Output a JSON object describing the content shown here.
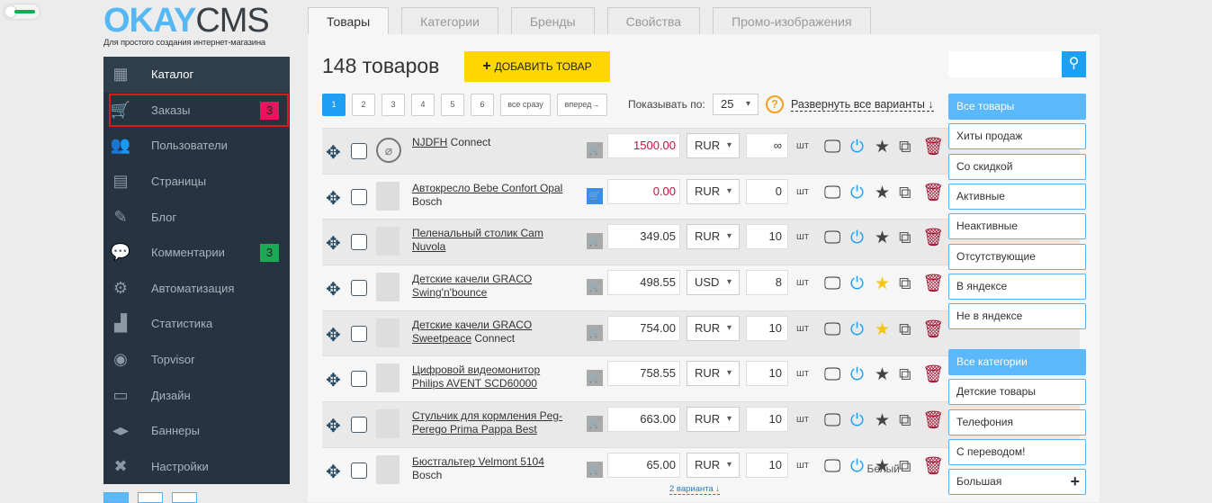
{
  "logo": {
    "okay": "OKAY",
    "cms": "CMS",
    "tagline": "Для простого создания интернет-магазина"
  },
  "sidebar": {
    "items": [
      {
        "label": "Каталог",
        "icon": "grid-icon",
        "active": true
      },
      {
        "label": "Заказы",
        "icon": "cart-icon",
        "badge": "3",
        "badge_color": "#e8155e",
        "highlighted": true
      },
      {
        "label": "Пользователи",
        "icon": "users-icon"
      },
      {
        "label": "Страницы",
        "icon": "page-icon"
      },
      {
        "label": "Блог",
        "icon": "edit-icon"
      },
      {
        "label": "Комментарии",
        "icon": "comments-icon",
        "badge": "3",
        "badge_color": "#1aaa55"
      },
      {
        "label": "Автоматизация",
        "icon": "gears-icon"
      },
      {
        "label": "Статистика",
        "icon": "chart-icon"
      },
      {
        "label": "Topvisor",
        "icon": "topvisor-icon"
      },
      {
        "label": "Дизайн",
        "icon": "design-icon"
      },
      {
        "label": "Баннеры",
        "icon": "banner-icon"
      },
      {
        "label": "Настройки",
        "icon": "tools-icon"
      }
    ]
  },
  "tabs": [
    "Товары",
    "Категории",
    "Бренды",
    "Свойства",
    "Промо-изображения"
  ],
  "main": {
    "title": "148 товаров",
    "add_button": "ДОБАВИТЬ ТОВАР",
    "pages": [
      "1",
      "2",
      "3",
      "4",
      "5",
      "6",
      "все сразу",
      "вперед→"
    ],
    "show_label": "Показывать по:",
    "per_page": "25",
    "help": "?",
    "expand": "Развернуть все варианты ↓"
  },
  "products": [
    {
      "link": "NJDFH",
      "rest": " Connect",
      "price": "1500.00",
      "currency": "RUR",
      "qty": "∞",
      "unit": "шт",
      "noimg": true,
      "price_red": true,
      "featured": false
    },
    {
      "link": "Автокресло Bebe Confort Opal",
      "rest": " Bosch",
      "price": "0.00",
      "currency": "RUR",
      "qty": "0",
      "unit": "шт",
      "price_red": true,
      "cart_blue": true,
      "featured": false
    },
    {
      "link": "Пеленальный столик Cam Nuvola",
      "rest": "",
      "price": "349.05",
      "currency": "RUR",
      "qty": "10",
      "unit": "шт",
      "featured": false
    },
    {
      "link": "Детские качели GRACO Swing'n'bounce",
      "rest": "",
      "price": "498.55",
      "currency": "USD",
      "qty": "8",
      "unit": "шт",
      "featured": true
    },
    {
      "link": "Детские качели GRACO Sweetpeace",
      "rest": " Connect",
      "price": "754.00",
      "currency": "RUR",
      "qty": "10",
      "unit": "шт",
      "featured": true
    },
    {
      "link": "Цифровой видеомонитор Philips AVENT SCD60000",
      "rest": "",
      "price": "758.55",
      "currency": "RUR",
      "qty": "10",
      "unit": "шт",
      "featured": false
    },
    {
      "link": "Стульчик для кормления Peg-Perego Prima Pappa Best",
      "rest": "",
      "price": "663.00",
      "currency": "RUR",
      "qty": "10",
      "unit": "шт",
      "featured": false
    },
    {
      "link": "Бюстгальтер Velmont 5104",
      "rest": " Bosch",
      "variant": "Белый",
      "price": "65.00",
      "currency": "RUR",
      "qty": "10",
      "unit": "шт",
      "more": "2 варианта ↓",
      "featured": false
    }
  ],
  "filters": [
    "Все товары",
    "Хиты продаж",
    "Со скидкой",
    "Активные",
    "Неактивные",
    "Отсутствующие",
    "В яндексе",
    "Не в яндексе"
  ],
  "categories": [
    "Все категории",
    "Детские товары",
    "Телефония",
    "С переводом!",
    "Большая"
  ],
  "colors": {
    "accent": "#1e9ff2",
    "sidebar": "#263340",
    "add": "#ffd600",
    "delete": "#a01030",
    "star_on": "#f5c518"
  }
}
